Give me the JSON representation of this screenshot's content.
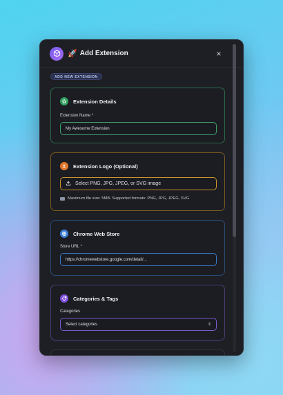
{
  "header": {
    "emoji": "🚀",
    "title": "Add Extension",
    "close": "×"
  },
  "badge": "ADD NEW EXTENSION",
  "details": {
    "title": "Extension Details",
    "name_label": "Extension Name *",
    "name_value": "My Awesome Extension",
    "accent": "#2f9e5e"
  },
  "logo": {
    "title": "Extension Logo (Optional)",
    "upload_label": "Select PNG, JPG, JPEG, or SVG image",
    "hint": "Maximum file size: 5MB. Supported formats: PNG, JPG, JPEG, SVG",
    "accent": "#e0762a"
  },
  "store": {
    "title": "Chrome Web Store",
    "url_label": "Store URL *",
    "url_placeholder": "https://chromewebstore.google.com/detail/...",
    "accent": "#3b7fd6"
  },
  "categories": {
    "title": "Categories & Tags",
    "label": "Categories",
    "select_value": "Select categories",
    "accent": "#7c4ddc"
  }
}
